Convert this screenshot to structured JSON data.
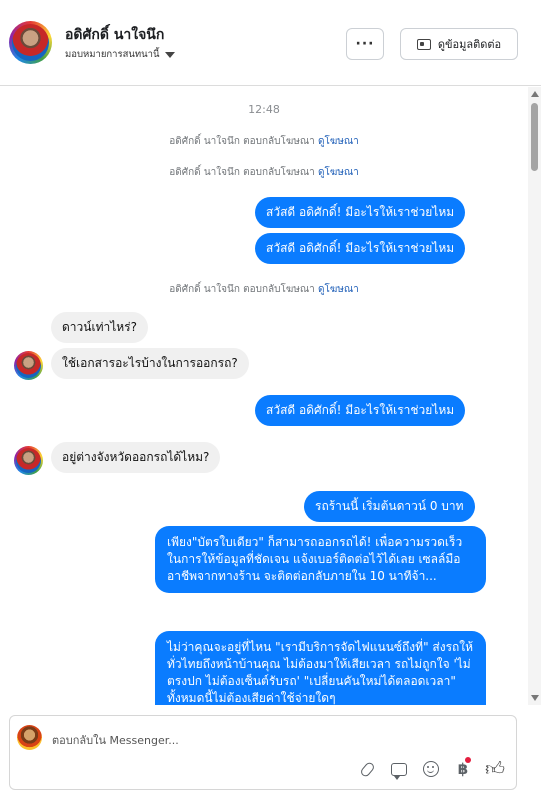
{
  "header": {
    "name": "อดิศักดิ์ นาใจนึก",
    "assign_label": "มอบหมายการสนทนานี้",
    "more_label": "···",
    "contact_label": "ดูข้อมูลติดต่อ"
  },
  "chat": {
    "timestamp": "12:48",
    "system_text": "อดิศักดิ์ นาใจนึก ตอบกลับโฆษณา",
    "system_link": "ดูโฆษณา",
    "messages": [
      {
        "dir": "out",
        "text": "สวัสดี อดิศักดิ์! มีอะไรให้เราช่วยไหม"
      },
      {
        "dir": "out",
        "text": "สวัสดี อดิศักดิ์! มีอะไรให้เราช่วยไหม"
      },
      {
        "dir": "in",
        "text": "ดาวน์เท่าไหร่?"
      },
      {
        "dir": "in",
        "text": "ใช้เอกสารอะไรบ้างในการออกรถ?"
      },
      {
        "dir": "out",
        "text": "สวัสดี อดิศักดิ์! มีอะไรให้เราช่วยไหม"
      },
      {
        "dir": "in",
        "text": "อยู่ต่างจังหวัดออกรถได้ไหม?"
      },
      {
        "dir": "out",
        "text": "รถร้านนี้ เริ่มต้นดาวน์ 0 บาท"
      },
      {
        "dir": "out",
        "text": "เพียง\"บัตรใบเดียว\" ก็สามารถออกรถได้! เพื่อความรวดเร็ว ในการให้ข้อมูลที่ชัดเจน แจ้งเบอร์ติดต่อไว้ได้เลย เซลล์มืออาชีพจากทางร้าน จะติดต่อกลับภายใน 10 นาทีจ้า..."
      },
      {
        "dir": "out",
        "text": "ไม่ว่าคุณจะอยู่ที่ไหน \"เรามีบริการจัดไฟแนนซ์ถึงที่\" ส่งรถให้ทั่วไทยถึงหน้าบ้านคุณ ไม่ต้องมาให้เสียเวลา รถไม่ถูกใจ 'ไม่ตรงปก ไม่ต้องเซ็นต์รับรถ' \"เปลี่ยนคันใหม่ได้ตลอดเวลา\" ทั้งหมดนี้ไม่ต้องเสียค่าใช้จ่ายใดๆ"
      }
    ]
  },
  "composer": {
    "placeholder": "ตอบกลับใน Messenger..."
  },
  "colors": {
    "outgoing_bubble": "#0a7cff",
    "incoming_bubble": "#f0f0f0",
    "link": "#1f5fb8",
    "notification_dot": "#e41e3f"
  },
  "icons": [
    "paperclip-icon",
    "saved-reply-icon",
    "emoji-icon",
    "baht-payment-icon",
    "like-thumb-icon"
  ]
}
